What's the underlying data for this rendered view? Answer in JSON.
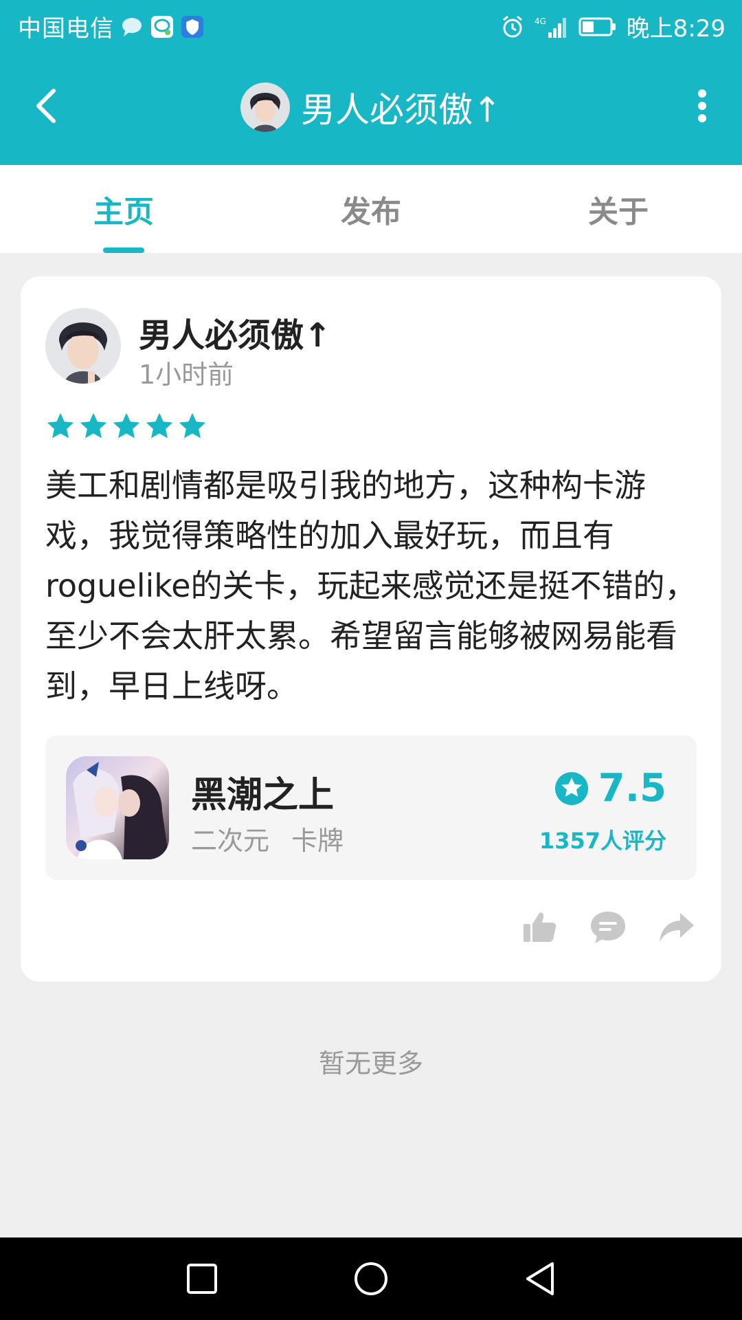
{
  "status_bar": {
    "carrier": "中国电信",
    "network": "4G",
    "time": "晚上8:29",
    "icons": [
      "chat-bubble-icon",
      "message-app-icon",
      "shield-icon",
      "alarm-icon",
      "signal-icon",
      "battery-icon"
    ]
  },
  "app_bar": {
    "title": "男人必须傲↑",
    "icons": [
      "back-arrow-icon",
      "more-vertical-icon"
    ]
  },
  "tabs": [
    {
      "label": "主页",
      "active": true
    },
    {
      "label": "发布",
      "active": false
    },
    {
      "label": "关于",
      "active": false
    }
  ],
  "review": {
    "author": "男人必须傲↑",
    "time": "1小时前",
    "rating_stars": 5,
    "text": "美工和剧情都是吸引我的地方，这种构卡游戏，我觉得策略性的加入最好玩，而且有roguelike的关卡，玩起来感觉还是挺不错的，至少不会太肝太累。希望留言能够被网易能看到，早日上线呀。",
    "game": {
      "name": "黑潮之上",
      "tags": "二次元 卡牌",
      "score": "7.5",
      "rating_count": "1357人评分"
    },
    "actions": [
      "thumbs-up-icon",
      "comment-icon",
      "share-icon"
    ]
  },
  "footer_text": "暂无更多",
  "nav_bar": [
    "recent-apps-icon",
    "home-icon",
    "back-icon"
  ],
  "colors": {
    "accent": "#17b7c6",
    "background": "#efefef",
    "card": "#ffffff",
    "text": "#222222",
    "muted": "#999999"
  }
}
